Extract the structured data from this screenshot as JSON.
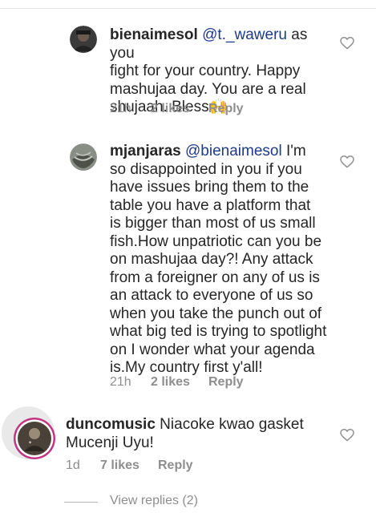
{
  "comments": [
    {
      "username": "bienaimesol",
      "mention": "@t._waweru",
      "lines": [
        " as you",
        "fight for your country. Happy",
        "mashujaa day. You are a real",
        "shujaah. Bless🙌"
      ],
      "time": "21h",
      "likes": "2 likes",
      "reply": "Reply",
      "avatar_icon": "profile-photo-icon"
    },
    {
      "username": "mjanjaras",
      "mention": "@bienaimesol",
      "lines": [
        " I'm",
        "so disappointed in you if you",
        "have issues bring them to the",
        "table you have a platform that",
        "is bigger than most of us small",
        "fish.How unpatriotic can you be",
        "on mashujaa day?! Any attack",
        "from a foreigner on any of us is",
        "an attack to everyone of us so",
        "when you take the punch out of",
        "what big ted is trying to spotlight",
        "on I wonder what your agenda",
        "is.My country first y'all!"
      ],
      "time": "21h",
      "likes": "2 likes",
      "reply": "Reply",
      "avatar_icon": "profile-photo-icon"
    },
    {
      "username": "duncomusic",
      "lines": [
        " Niacoke kwao gasket",
        "Mucenji Uyu!"
      ],
      "time": "1d",
      "likes": "7 likes",
      "reply": "Reply",
      "avatar_icon": "story-ring-profile-photo-icon"
    }
  ],
  "view_replies": "View replies (2)",
  "colors": {
    "text": "#262626",
    "meta": "#8e8e8e",
    "mention": "#1e3a8a",
    "story_ring": "#c13584"
  }
}
